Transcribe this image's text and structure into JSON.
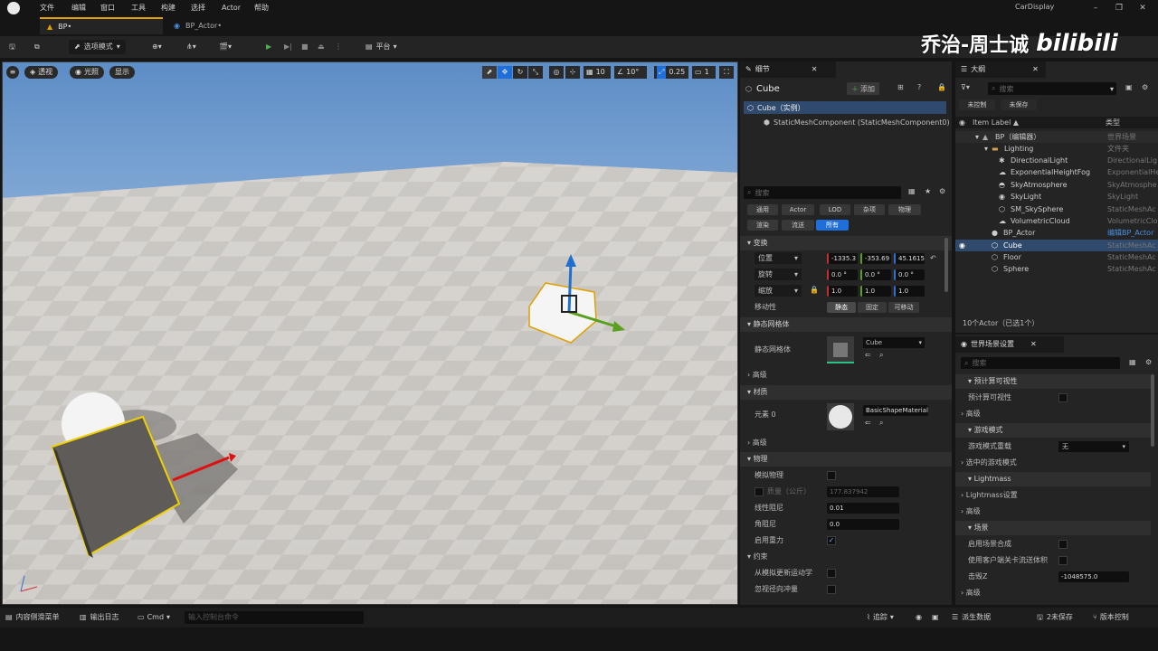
{
  "menu": [
    "文件",
    "编辑",
    "窗口",
    "工具",
    "构建",
    "选择",
    "Actor",
    "帮助"
  ],
  "window_title": "CarDisplay",
  "tabs": {
    "bp": "BP•",
    "actor": "BP_Actor•"
  },
  "toolbar": {
    "mode": "选项模式",
    "platform": "平台"
  },
  "watermark": {
    "text": "乔治-周士诚",
    "logo": "bilibili"
  },
  "viewport": {
    "perspective": "透视",
    "lighting": "光照",
    "show": "显示",
    "grid_size": "10",
    "rotation_snap": "10°",
    "scale_snap": "0.25",
    "camera_speed": "1"
  },
  "details": {
    "tab_label": "细节",
    "object_name": "Cube",
    "add_button": "添加",
    "component_root": "Cube（实例）",
    "component_child": "StaticMeshComponent (StaticMeshComponent0)",
    "search_placeholder": "搜索",
    "filters": [
      "通用",
      "Actor",
      "LOD",
      "杂项",
      "物理",
      "渲染",
      "流送",
      "所有"
    ],
    "transform": {
      "section": "变换",
      "location_label": "位置",
      "rotation_label": "旋转",
      "scale_label": "缩放",
      "location": [
        "-1335.3",
        "-353.69",
        "45.1615"
      ],
      "rotation": [
        "0.0 °",
        "0.0 °",
        "0.0 °"
      ],
      "scale": [
        "1.0",
        "1.0",
        "1.0"
      ],
      "mobility_label": "移动性",
      "mobility": [
        "静态",
        "固定",
        "可移动"
      ]
    },
    "static_mesh": {
      "section": "静态网格体",
      "label": "静态网格体",
      "value": "Cube",
      "advanced": "高级"
    },
    "materials": {
      "section": "材质",
      "element_label": "元素 0",
      "value": "BasicShapeMaterial",
      "advanced": "高级"
    },
    "physics": {
      "section": "物理",
      "simulate": "模拟物理",
      "mass_label": "质量（公斤）",
      "mass_value": "177.837942",
      "linear_damping_label": "线性阻尼",
      "linear_damping": "0.01",
      "angular_damping_label": "角阻尼",
      "angular_damping": "0.0",
      "gravity": "启用重力"
    },
    "constraints": {
      "section": "约束",
      "update_from_sim": "从模拟更新运动学",
      "ignore_radial_impulse": "忽视径向冲量"
    }
  },
  "outliner": {
    "tab_label": "大纲",
    "search_placeholder": "搜索",
    "unsaved": "未控制",
    "not_saved": "未保存",
    "col_label": "Item Label ▲",
    "col_type": "类型",
    "rows": [
      {
        "label": "BP（编辑器）",
        "type": "世界场景",
        "indent": 0
      },
      {
        "label": "Lighting",
        "type": "文件夹",
        "indent": 1
      },
      {
        "label": "DirectionalLight",
        "type": "DirectionalLig",
        "indent": 2
      },
      {
        "label": "ExponentialHeightFog",
        "type": "ExponentialHe",
        "indent": 2
      },
      {
        "label": "SkyAtmosphere",
        "type": "SkyAtmosphe",
        "indent": 2
      },
      {
        "label": "SkyLight",
        "type": "SkyLight",
        "indent": 2
      },
      {
        "label": "SM_SkySphere",
        "type": "StaticMeshAc",
        "indent": 2
      },
      {
        "label": "VolumetricCloud",
        "type": "VolumetricClo",
        "indent": 2
      },
      {
        "label": "BP_Actor",
        "type": "编辑BP_Actor",
        "indent": 1
      },
      {
        "label": "Cube",
        "type": "StaticMeshAc",
        "indent": 1
      },
      {
        "label": "Floor",
        "type": "StaticMeshAc",
        "indent": 1
      },
      {
        "label": "Sphere",
        "type": "StaticMeshAc",
        "indent": 1
      }
    ],
    "footer": "10个Actor（已选1个）"
  },
  "world_settings": {
    "tab_label": "世界场景设置",
    "search_placeholder": "搜索",
    "rows": [
      {
        "kind": "section",
        "label": "预计算可视性"
      },
      {
        "kind": "check",
        "label": "预计算可视性"
      },
      {
        "kind": "sub",
        "label": "高级"
      },
      {
        "kind": "section",
        "label": "游戏模式"
      },
      {
        "kind": "dropdown",
        "label": "游戏模式重载",
        "value": "无"
      },
      {
        "kind": "sub",
        "label": "选中的游戏模式"
      },
      {
        "kind": "section",
        "label": "Lightmass"
      },
      {
        "kind": "sub",
        "label": "Lightmass设置"
      },
      {
        "kind": "sub",
        "label": "高级"
      },
      {
        "kind": "section",
        "label": "场景"
      },
      {
        "kind": "check",
        "label": "启用场景合成"
      },
      {
        "kind": "check",
        "label": "使用客户端关卡流送体积"
      },
      {
        "kind": "field",
        "label": "击毁Z",
        "value": "-1048575.0"
      },
      {
        "kind": "sub",
        "label": "高级"
      }
    ]
  },
  "statusbar": {
    "content_drawer": "内容侧滑菜单",
    "output_log": "输出日志",
    "cmd": "Cmd",
    "cmd_placeholder": "输入控制台命令",
    "trace": "追踪",
    "derived_data": "派生数据",
    "unsaved": "2未保存",
    "source_control": "版本控制"
  },
  "colors": {
    "accent": "#e0a000",
    "selected": "#2f4a6d",
    "play_green": "#4caf50",
    "active_filter": "#1e6fd9"
  }
}
